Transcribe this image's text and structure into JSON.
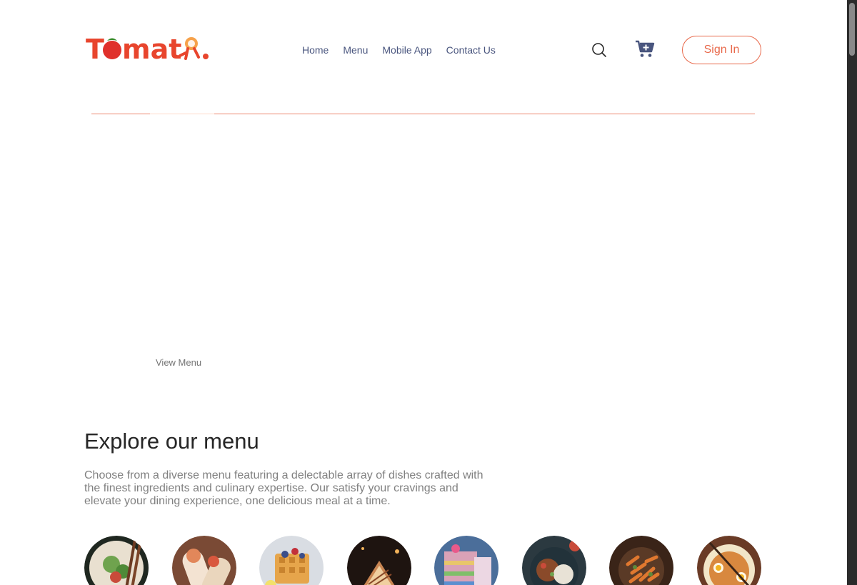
{
  "brand": {
    "logo_text": "Tomato."
  },
  "nav": {
    "links": [
      "Home",
      "Menu",
      "Mobile App",
      "Contact Us"
    ],
    "signin_label": "Sign In"
  },
  "hero": {
    "view_menu_label": "View Menu"
  },
  "explore": {
    "title": "Explore our menu",
    "description": "Choose from a diverse menu featuring a delectable array of dishes crafted with the finest ingredients and culinary expertise. Our satisfy your cravings and elevate your dining experience, one delicious meal at a time."
  },
  "menu_items": [
    {
      "icon": "salad-icon",
      "colors": [
        "#2f3b2a",
        "#6fa34e",
        "#e9e0d0"
      ]
    },
    {
      "icon": "rolls-icon",
      "colors": [
        "#7a4a35",
        "#e2875a",
        "#f3e3d2"
      ]
    },
    {
      "icon": "deserts-icon",
      "colors": [
        "#d9dde3",
        "#e6a54b",
        "#3b4e8a"
      ]
    },
    {
      "icon": "sandwich-icon",
      "colors": [
        "#1e1410",
        "#c98552",
        "#f0cfa0"
      ]
    },
    {
      "icon": "cake-icon",
      "colors": [
        "#4b6e9a",
        "#d9a2b7",
        "#e8c66b"
      ]
    },
    {
      "icon": "pure-veg-icon",
      "colors": [
        "#2b3940",
        "#8a4a2a",
        "#e8e2d6"
      ]
    },
    {
      "icon": "pasta-icon",
      "colors": [
        "#3a2418",
        "#e0782f",
        "#5e8a3a"
      ]
    },
    {
      "icon": "noodles-icon",
      "colors": [
        "#6a3b26",
        "#d8883f",
        "#f2e6c8"
      ]
    }
  ],
  "colors": {
    "accent": "#e8684a",
    "nav_text": "#49557e"
  }
}
